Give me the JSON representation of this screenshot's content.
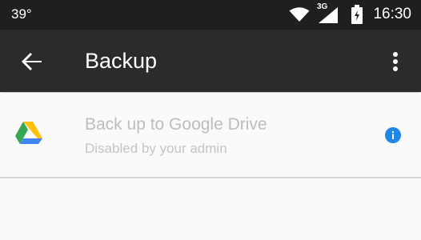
{
  "status_bar": {
    "temperature": "39°",
    "network_type": "3G",
    "time": "16:30",
    "icons": [
      "wifi-icon",
      "cell-signal-icon",
      "battery-icon"
    ]
  },
  "app_bar": {
    "title": "Backup",
    "back_icon": "arrow-back-icon",
    "overflow_icon": "more-vert-icon",
    "background": "#2b2b2b"
  },
  "preference": {
    "title": "Back up to Google Drive",
    "summary": "Disabled by your admin",
    "icon": "google-drive-icon",
    "info_icon": "info-icon",
    "info_color": "#1e88e5",
    "enabled": false
  }
}
